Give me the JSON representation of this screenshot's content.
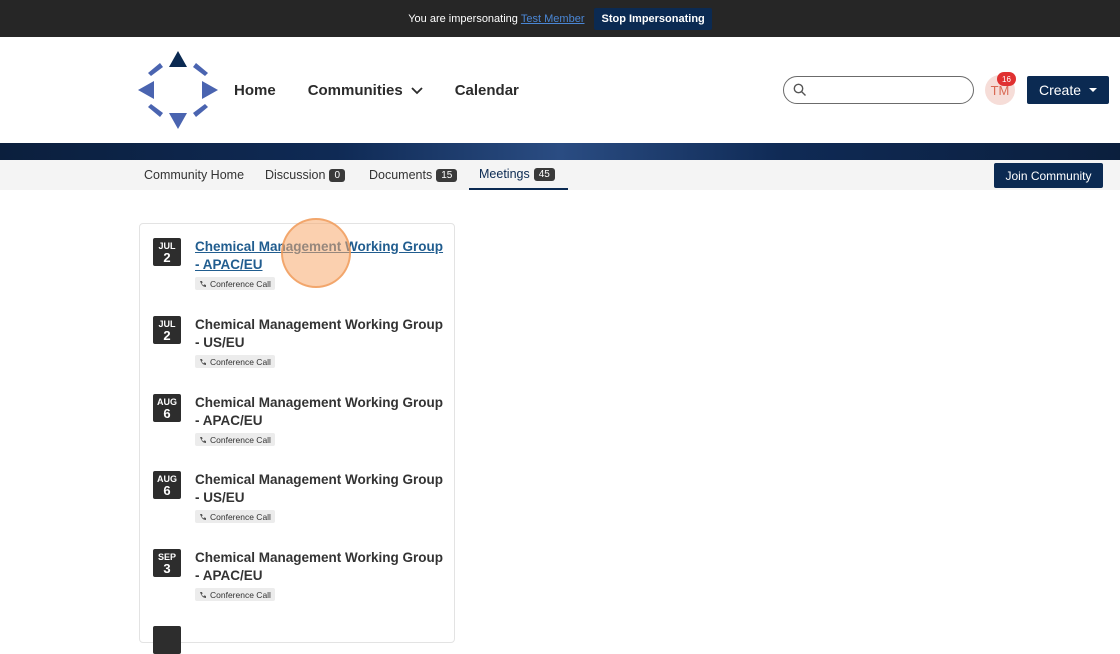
{
  "impersonation": {
    "text": "You are impersonating",
    "member_link": "Test Member",
    "stop_label": "Stop Impersonating"
  },
  "nav": {
    "home": "Home",
    "communities": "Communities",
    "calendar": "Calendar"
  },
  "search": {
    "placeholder": ""
  },
  "user": {
    "initials": "TM",
    "notifications": "16"
  },
  "create": {
    "label": "Create"
  },
  "tabs": [
    {
      "label": "Community Home"
    },
    {
      "label": "Discussion",
      "count": "0"
    },
    {
      "label": "Documents",
      "count": "15"
    },
    {
      "label": "Meetings",
      "count": "45"
    }
  ],
  "join": {
    "label": "Join Community"
  },
  "meetings": [
    {
      "month": "JUL",
      "day": "2",
      "title": "Chemical Management Working Group - APAC/EU",
      "type": "Conference Call"
    },
    {
      "month": "JUL",
      "day": "2",
      "title": "Chemical Management Working Group - US/EU",
      "type": "Conference Call"
    },
    {
      "month": "AUG",
      "day": "6",
      "title": "Chemical Management Working Group - APAC/EU",
      "type": "Conference Call"
    },
    {
      "month": "AUG",
      "day": "6",
      "title": "Chemical Management Working Group - US/EU",
      "type": "Conference Call"
    },
    {
      "month": "SEP",
      "day": "3",
      "title": "Chemical Management Working Group - APAC/EU",
      "type": "Conference Call"
    }
  ],
  "colors": {
    "brand": "#0b2a52",
    "link": "#215d8f",
    "badge": "#e03131"
  }
}
